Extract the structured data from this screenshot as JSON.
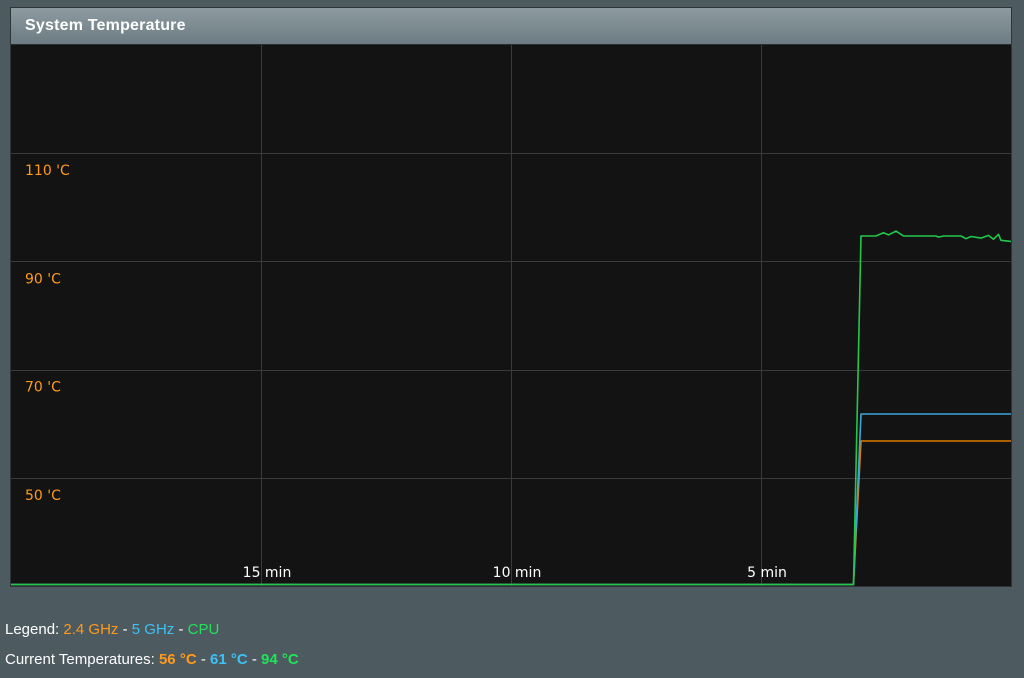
{
  "panel": {
    "title": "System Temperature"
  },
  "legend": {
    "label": "Legend:",
    "sep": " - ",
    "items": [
      "2.4 GHz",
      "5 GHz",
      "CPU"
    ]
  },
  "current": {
    "label": "Current Temperatures:",
    "sep": " - ",
    "values": [
      "56 °C",
      "61 °C",
      "94 °C"
    ]
  },
  "colors": {
    "ghz24": "#e07b00",
    "ghz5": "#3aa6d6",
    "cpu": "#22c84a",
    "grid": "#3a3a3a",
    "axis_label": "#ff9a1a",
    "time_label": "#ffffff"
  },
  "chart_data": {
    "type": "line",
    "x_unit": "minutes ago",
    "x_range": [
      20,
      0
    ],
    "x_ticks": [
      {
        "value": 15,
        "label": "15 min"
      },
      {
        "value": 10,
        "label": "10 min"
      },
      {
        "value": 5,
        "label": "5 min"
      }
    ],
    "ylim": [
      30,
      130
    ],
    "y_ticks": [
      {
        "value": 110,
        "label": "110 'C"
      },
      {
        "value": 90,
        "label": "90 'C"
      },
      {
        "value": 70,
        "label": "70 'C"
      },
      {
        "value": 50,
        "label": "50 'C"
      }
    ],
    "grid": true,
    "series": [
      {
        "name": "2.4 GHz",
        "color_key": "ghz24",
        "points": [
          [
            20,
            30
          ],
          [
            3.15,
            30
          ],
          [
            3.0,
            56.8
          ],
          [
            0,
            56.8
          ]
        ]
      },
      {
        "name": "5 GHz",
        "color_key": "ghz5",
        "points": [
          [
            20,
            30
          ],
          [
            3.15,
            30
          ],
          [
            3.0,
            61.8
          ],
          [
            0,
            61.8
          ]
        ]
      },
      {
        "name": "CPU",
        "color_key": "cpu",
        "points": [
          [
            20,
            30
          ],
          [
            3.15,
            30
          ],
          [
            3.0,
            94.7
          ],
          [
            2.7,
            94.7
          ],
          [
            2.55,
            95.3
          ],
          [
            2.45,
            94.9
          ],
          [
            2.3,
            95.6
          ],
          [
            2.15,
            94.7
          ],
          [
            1.5,
            94.7
          ],
          [
            1.45,
            94.5
          ],
          [
            1.35,
            94.7
          ],
          [
            1.0,
            94.7
          ],
          [
            0.9,
            94.2
          ],
          [
            0.8,
            94.6
          ],
          [
            0.6,
            94.3
          ],
          [
            0.45,
            94.8
          ],
          [
            0.35,
            94.1
          ],
          [
            0.25,
            95.0
          ],
          [
            0.2,
            93.9
          ],
          [
            0,
            93.7
          ]
        ]
      }
    ]
  }
}
